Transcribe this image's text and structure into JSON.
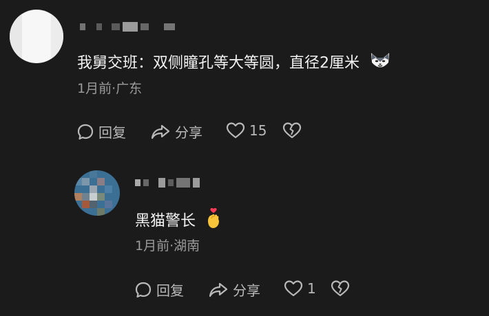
{
  "comments": [
    {
      "text": "我舅交班：双侧瞳孔等大等圆，直径2厘米",
      "emoji": "wolf-emoji",
      "time": "1月前",
      "location": "广东",
      "reply_label": "回复",
      "share_label": "分享",
      "likes": "15"
    },
    {
      "text": "黑猫警长",
      "emoji": "finger-heart-emoji",
      "time": "1月前",
      "location": "湖南",
      "reply_label": "回复",
      "share_label": "分享",
      "likes": "1"
    }
  ],
  "separator": "·",
  "colors": {
    "background": "#1b1b1b",
    "text_primary": "#f2f2f2",
    "text_secondary": "#9b9b9b",
    "icon": "#b9b9b9"
  }
}
